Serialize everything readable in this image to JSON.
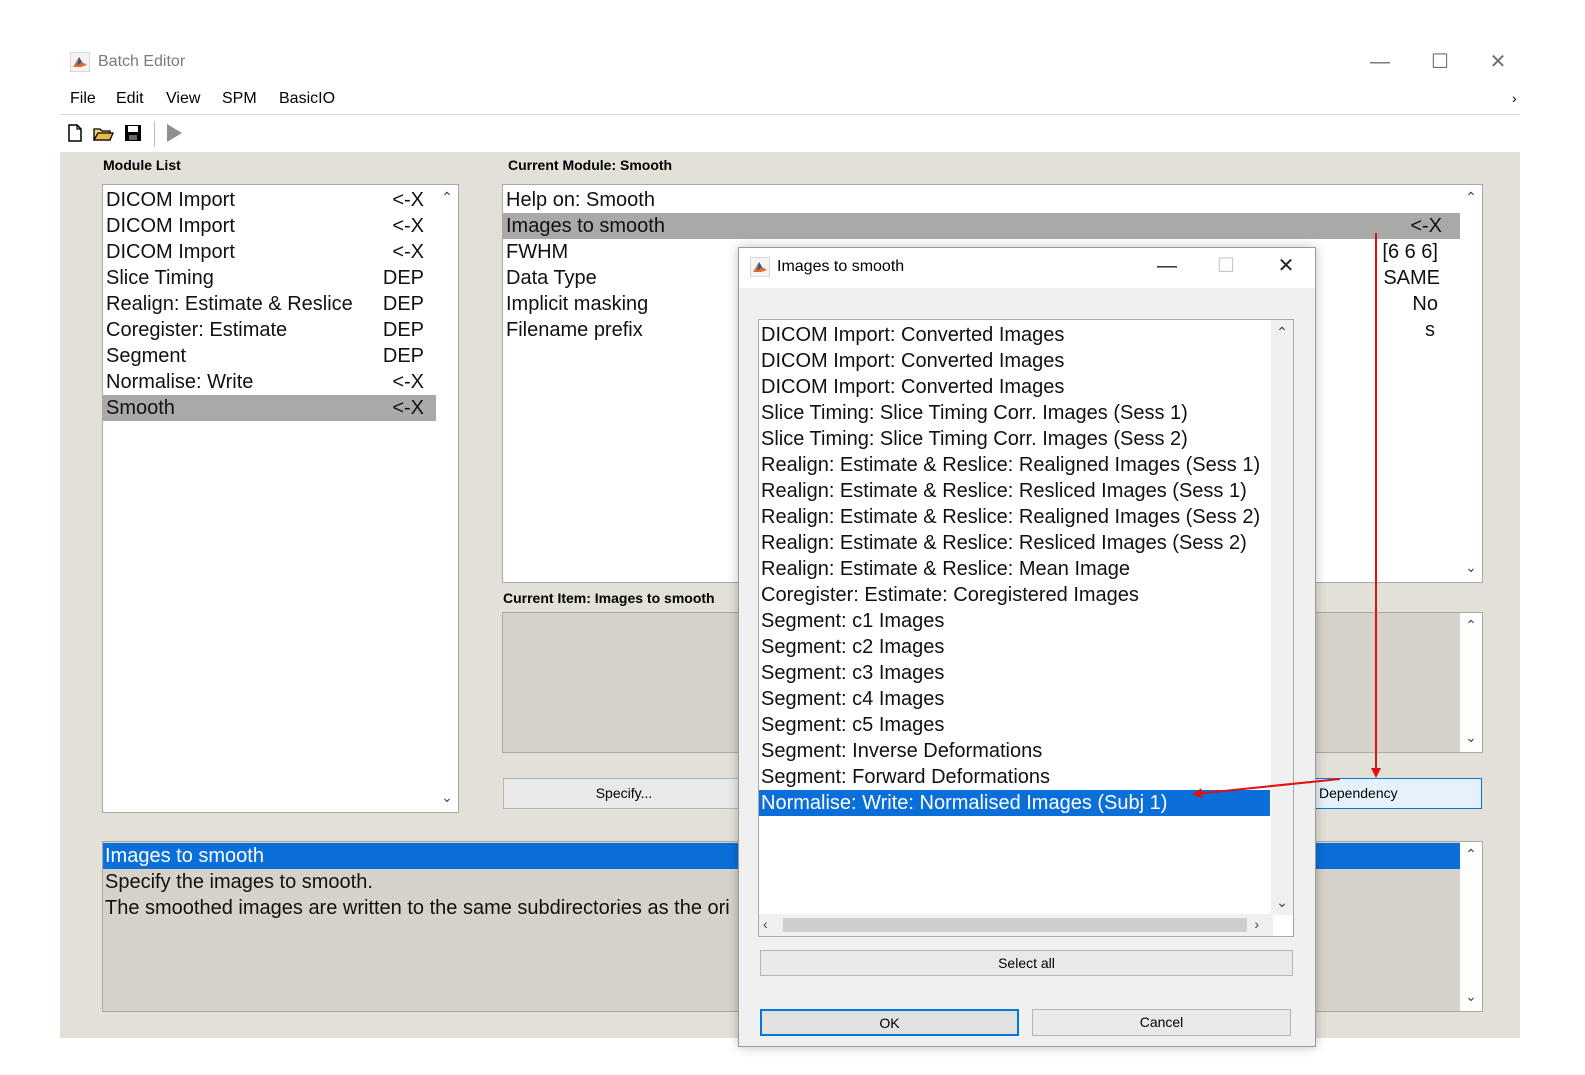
{
  "window": {
    "title": "Batch Editor"
  },
  "menu": [
    "File",
    "Edit",
    "View",
    "SPM",
    "BasicIO"
  ],
  "toolbar": {
    "icons": [
      "new-file-icon",
      "open-folder-icon",
      "save-icon",
      "run-icon"
    ]
  },
  "module_list": {
    "label": "Module List",
    "items": [
      {
        "name": "DICOM Import",
        "status": "<-X"
      },
      {
        "name": "DICOM Import",
        "status": "<-X"
      },
      {
        "name": "DICOM Import",
        "status": "<-X"
      },
      {
        "name": "Slice Timing",
        "status": "DEP"
      },
      {
        "name": "Realign: Estimate & Reslice",
        "status": "DEP"
      },
      {
        "name": "Coregister: Estimate",
        "status": "DEP"
      },
      {
        "name": "Segment",
        "status": "DEP"
      },
      {
        "name": "Normalise: Write",
        "status": "<-X"
      },
      {
        "name": "Smooth",
        "status": "<-X"
      }
    ],
    "selected_index": 8
  },
  "current_module": {
    "label": "Current Module: Smooth",
    "items": [
      {
        "name": "Help on: Smooth",
        "value": ""
      },
      {
        "name": "Images to smooth",
        "value": "<-X"
      },
      {
        "name": "FWHM",
        "value": "[6 6 6]"
      },
      {
        "name": "Data Type",
        "value": "SAME"
      },
      {
        "name": "Implicit masking",
        "value": "No"
      },
      {
        "name": "Filename prefix",
        "value": "s"
      }
    ],
    "selected_index": 1
  },
  "current_item": {
    "label": "Current Item: Images to smooth"
  },
  "buttons": {
    "specify": "Specify...",
    "dependency": "Dependency"
  },
  "help": {
    "title": "Images to smooth",
    "lines": [
      "Specify the images to smooth.",
      "The smoothed images are written to the same subdirectories as the ori"
    ]
  },
  "dialog": {
    "title": "Images to smooth",
    "items": [
      "DICOM Import: Converted Images",
      "DICOM Import: Converted Images",
      "DICOM Import: Converted Images",
      "Slice Timing: Slice Timing Corr. Images (Sess 1)",
      "Slice Timing: Slice Timing Corr. Images (Sess 2)",
      "Realign: Estimate & Reslice: Realigned Images (Sess 1)",
      "Realign: Estimate & Reslice: Resliced Images (Sess 1)",
      "Realign: Estimate & Reslice: Realigned Images (Sess 2)",
      "Realign: Estimate & Reslice: Resliced Images (Sess 2)",
      "Realign: Estimate & Reslice: Mean Image",
      "Coregister: Estimate: Coregistered Images",
      "Segment: c1 Images",
      "Segment: c2 Images",
      "Segment: c3 Images",
      "Segment: c4 Images",
      "Segment: c5 Images",
      "Segment: Inverse Deformations",
      "Segment: Forward Deformations",
      "Normalise: Write: Normalised Images (Subj 1)"
    ],
    "selected_index": 18,
    "select_all": "Select all",
    "ok": "OK",
    "cancel": "Cancel"
  },
  "annotation_color": "#e01010",
  "selection_color": "#0a6fd8"
}
